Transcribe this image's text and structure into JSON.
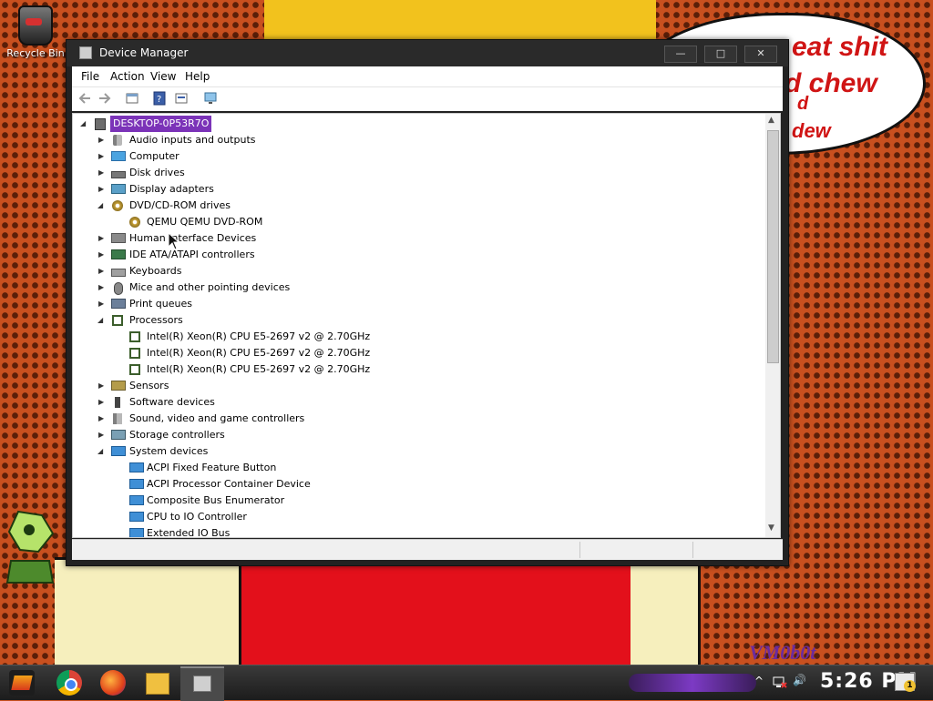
{
  "desktop": {
    "recycle_bin_label": "Recycle Bin",
    "bubble_text": [
      "eat shit",
      "d chew",
      "d",
      "dew"
    ],
    "signature": "VM0b0t"
  },
  "window": {
    "title": "Device Manager",
    "minimize": "—",
    "maximize": "□",
    "close": "✕"
  },
  "menu": [
    "File",
    "Action",
    "View",
    "Help"
  ],
  "toolbar_icons": [
    "back-icon",
    "forward-icon",
    "properties-icon",
    "help-icon",
    "update-driver-icon",
    "monitor-icon"
  ],
  "tree": {
    "root": "DESKTOP-0P53R7O",
    "categories": [
      {
        "label": "Audio inputs and outputs",
        "icon": "audio-icon",
        "expanded": false,
        "children": []
      },
      {
        "label": "Computer",
        "icon": "monitor-icon",
        "expanded": false,
        "children": []
      },
      {
        "label": "Disk drives",
        "icon": "disk-icon",
        "expanded": false,
        "children": []
      },
      {
        "label": "Display adapters",
        "icon": "display-adapter-icon",
        "expanded": false,
        "children": []
      },
      {
        "label": "DVD/CD-ROM drives",
        "icon": "dvd-icon",
        "expanded": true,
        "children": [
          "QEMU QEMU DVD-ROM"
        ]
      },
      {
        "label": "Human Interface Devices",
        "icon": "hid-icon",
        "expanded": false,
        "children": []
      },
      {
        "label": "IDE ATA/ATAPI controllers",
        "icon": "ide-icon",
        "expanded": false,
        "children": []
      },
      {
        "label": "Keyboards",
        "icon": "keyboard-icon",
        "expanded": false,
        "children": []
      },
      {
        "label": "Mice and other pointing devices",
        "icon": "mouse-icon",
        "expanded": false,
        "children": []
      },
      {
        "label": "Print queues",
        "icon": "printer-icon",
        "expanded": false,
        "children": []
      },
      {
        "label": "Processors",
        "icon": "processor-icon",
        "expanded": true,
        "children": [
          "Intel(R) Xeon(R) CPU E5-2697 v2 @ 2.70GHz",
          "Intel(R) Xeon(R) CPU E5-2697 v2 @ 2.70GHz",
          "Intel(R) Xeon(R) CPU E5-2697 v2 @ 2.70GHz"
        ]
      },
      {
        "label": "Sensors",
        "icon": "sensor-icon",
        "expanded": false,
        "children": []
      },
      {
        "label": "Software devices",
        "icon": "software-device-icon",
        "expanded": false,
        "children": []
      },
      {
        "label": "Sound, video and game controllers",
        "icon": "sound-icon",
        "expanded": false,
        "children": []
      },
      {
        "label": "Storage controllers",
        "icon": "storage-icon",
        "expanded": false,
        "children": []
      },
      {
        "label": "System devices",
        "icon": "system-device-icon",
        "expanded": true,
        "children": [
          "ACPI Fixed Feature Button",
          "ACPI Processor Container Device",
          "Composite Bus Enumerator",
          "CPU to IO Controller",
          "Extended IO Bus"
        ]
      }
    ]
  },
  "taskbar": {
    "apps": [
      "start-icon",
      "chrome-icon",
      "firefox-icon",
      "file-explorer-icon",
      "device-manager-icon"
    ],
    "tray_chevron": "^",
    "volume": "🔊",
    "clock": "5:26 PM",
    "notification_count": "1"
  }
}
